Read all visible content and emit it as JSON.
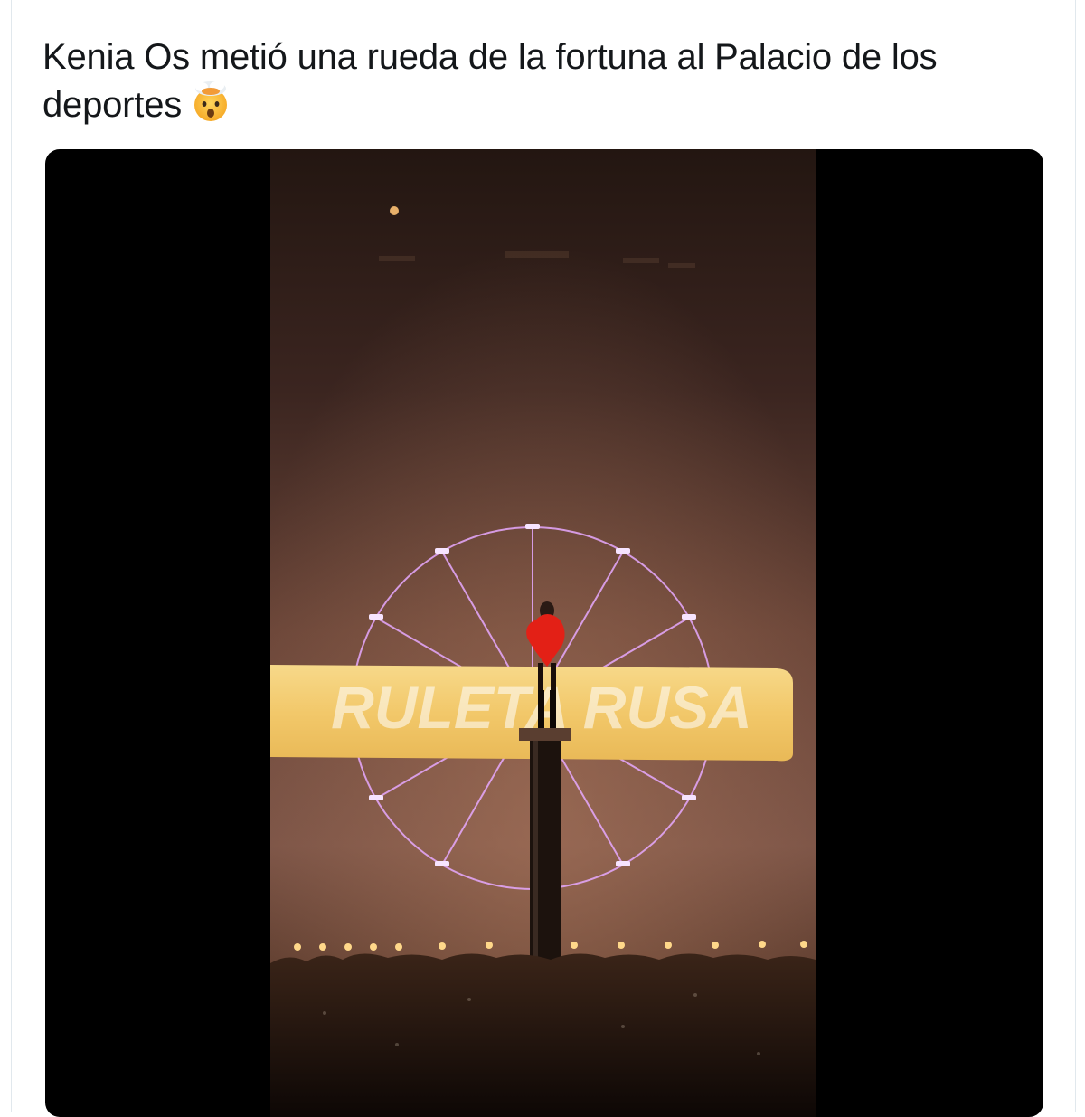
{
  "tweet": {
    "text": "Kenia Os metió una rueda de la fortuna al Palacio de los deportes",
    "emoji_icon": "exploding-head-emoji"
  },
  "media": {
    "type": "video",
    "banner_text": "RULETA RUSA",
    "colors": {
      "letterbox": "#000000",
      "banner": "#f2c86a",
      "wheel": "#e7a9ff",
      "dress": "#e32016",
      "haze": "#6a3a2a"
    }
  }
}
